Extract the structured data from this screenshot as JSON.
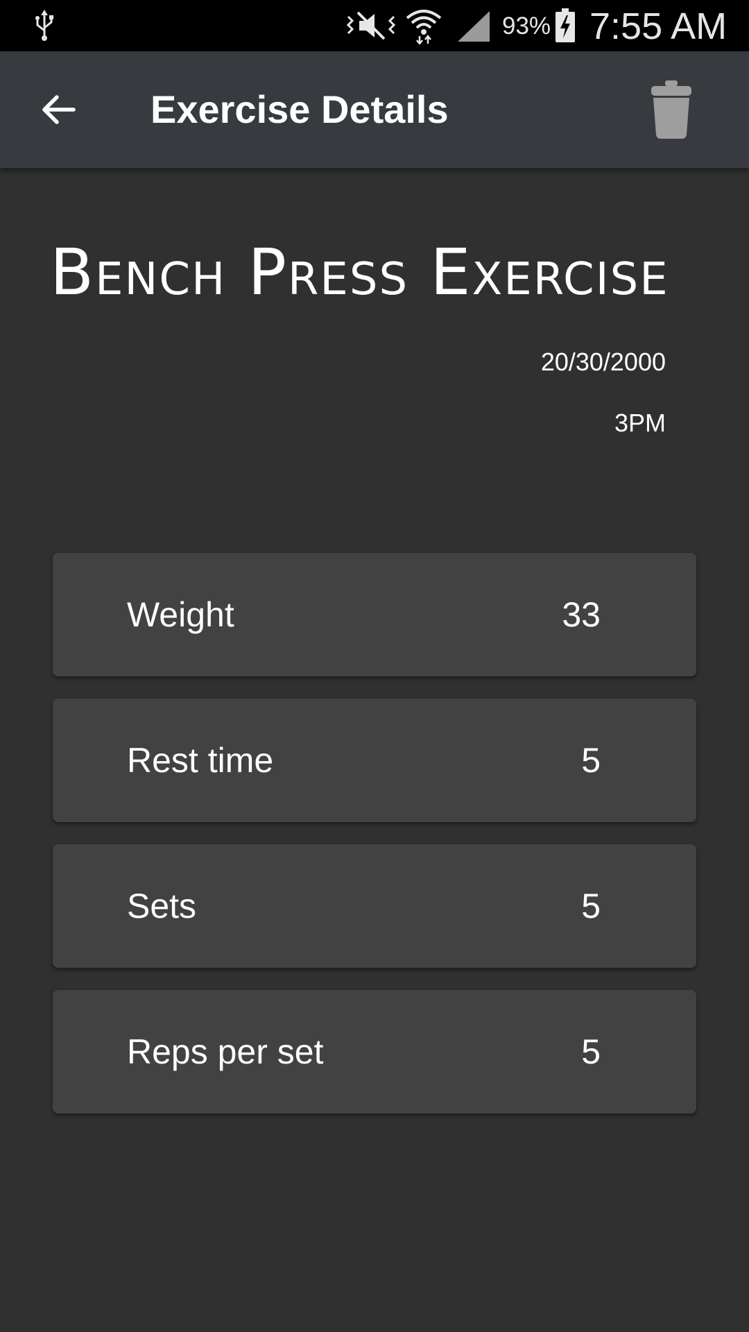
{
  "status_bar": {
    "battery_percent": "93%",
    "clock": "7:55 AM",
    "icons": [
      "usb-icon",
      "mute-icon",
      "wifi-icon",
      "signal-icon",
      "battery-charging-icon"
    ]
  },
  "app_bar": {
    "title": "Exercise Details",
    "back_icon": "arrow-back-icon",
    "delete_icon": "trash-icon"
  },
  "exercise": {
    "name": "Bench Press Exercise",
    "date": "20/30/2000",
    "time": "3PM"
  },
  "details": [
    {
      "label": "Weight",
      "value": "33"
    },
    {
      "label": "Rest time",
      "value": "5"
    },
    {
      "label": "Sets",
      "value": "5"
    },
    {
      "label": "Reps per set",
      "value": "5"
    }
  ],
  "colors": {
    "background": "#303030",
    "app_bar": "#373a3f",
    "card": "#424242",
    "status_bar": "#000000",
    "trash_icon": "#9e9e9e"
  }
}
